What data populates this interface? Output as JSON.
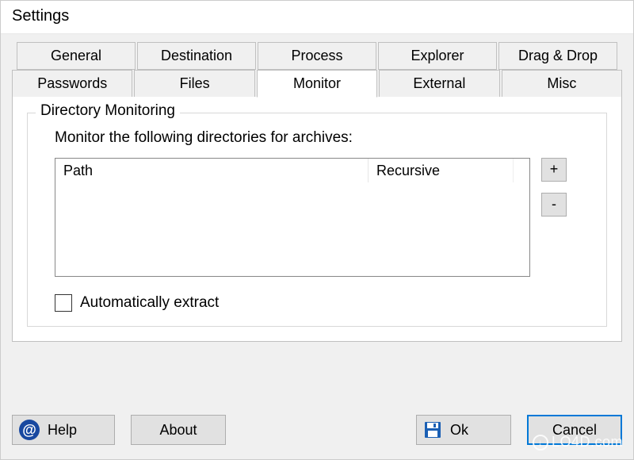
{
  "window": {
    "title": "Settings"
  },
  "tabs": {
    "row1": [
      "General",
      "Destination",
      "Process",
      "Explorer",
      "Drag & Drop"
    ],
    "row2": [
      "Passwords",
      "Files",
      "Monitor",
      "External",
      "Misc"
    ],
    "active": "Monitor"
  },
  "monitor": {
    "groupLabel": "Directory Monitoring",
    "instruction": "Monitor the following directories for archives:",
    "columns": {
      "path": "Path",
      "recursive": "Recursive"
    },
    "rows": [],
    "addBtn": "+",
    "removeBtn": "-",
    "autoExtractLabel": "Automatically extract",
    "autoExtractChecked": false
  },
  "buttons": {
    "help": "Help",
    "about": "About",
    "ok": "Ok",
    "cancel": "Cancel"
  },
  "watermark": "LO4D.com"
}
